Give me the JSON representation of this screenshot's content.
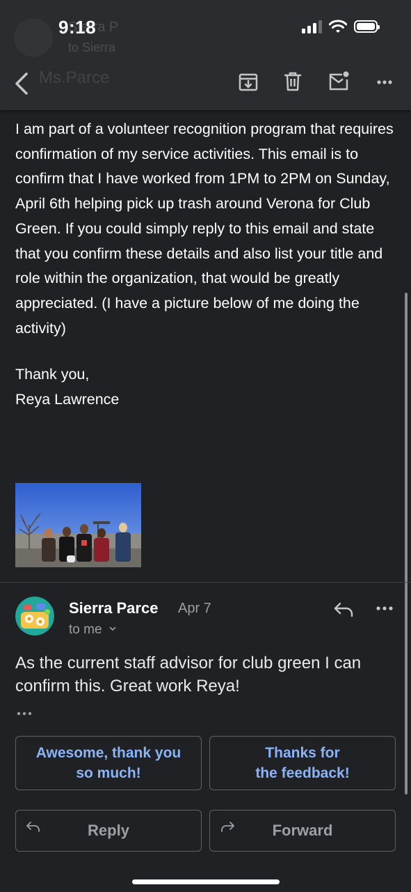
{
  "status_bar": {
    "time": "9:18"
  },
  "header": {
    "ghost_name": "Sierra P",
    "ghost_subtitle": "to Sierra",
    "ghost_back_label": "Ms.Parce"
  },
  "email_body": {
    "paragraph": "I am part of a volunteer recognition program that requires confirmation of my service activities. This email is to confirm that I have worked from 1PM to 2PM on Sunday, April 6th helping pick up trash around Verona for Club Green. If you could simply reply to this email and state that you confirm these details and also list your title and role within the organization, that would be greatly appreciated. (I have a picture below of me doing the activity)",
    "closing": "Thank you,",
    "signature": "Reya Lawrence"
  },
  "reply_message": {
    "sender": "Sierra Parce",
    "date": "Apr 7",
    "recipient": "to me",
    "body": "As the current staff advisor for club green I can confirm this. Great work Reya!"
  },
  "smart_replies": [
    {
      "line1": "Awesome, thank you",
      "line2": "so much!"
    },
    {
      "line1": "Thanks for",
      "line2": "the feedback!"
    }
  ],
  "actions": {
    "reply": "Reply",
    "forward": "Forward"
  },
  "colors": {
    "background": "#202124",
    "link": "#8ab4f8",
    "muted": "#9aa0a6"
  }
}
